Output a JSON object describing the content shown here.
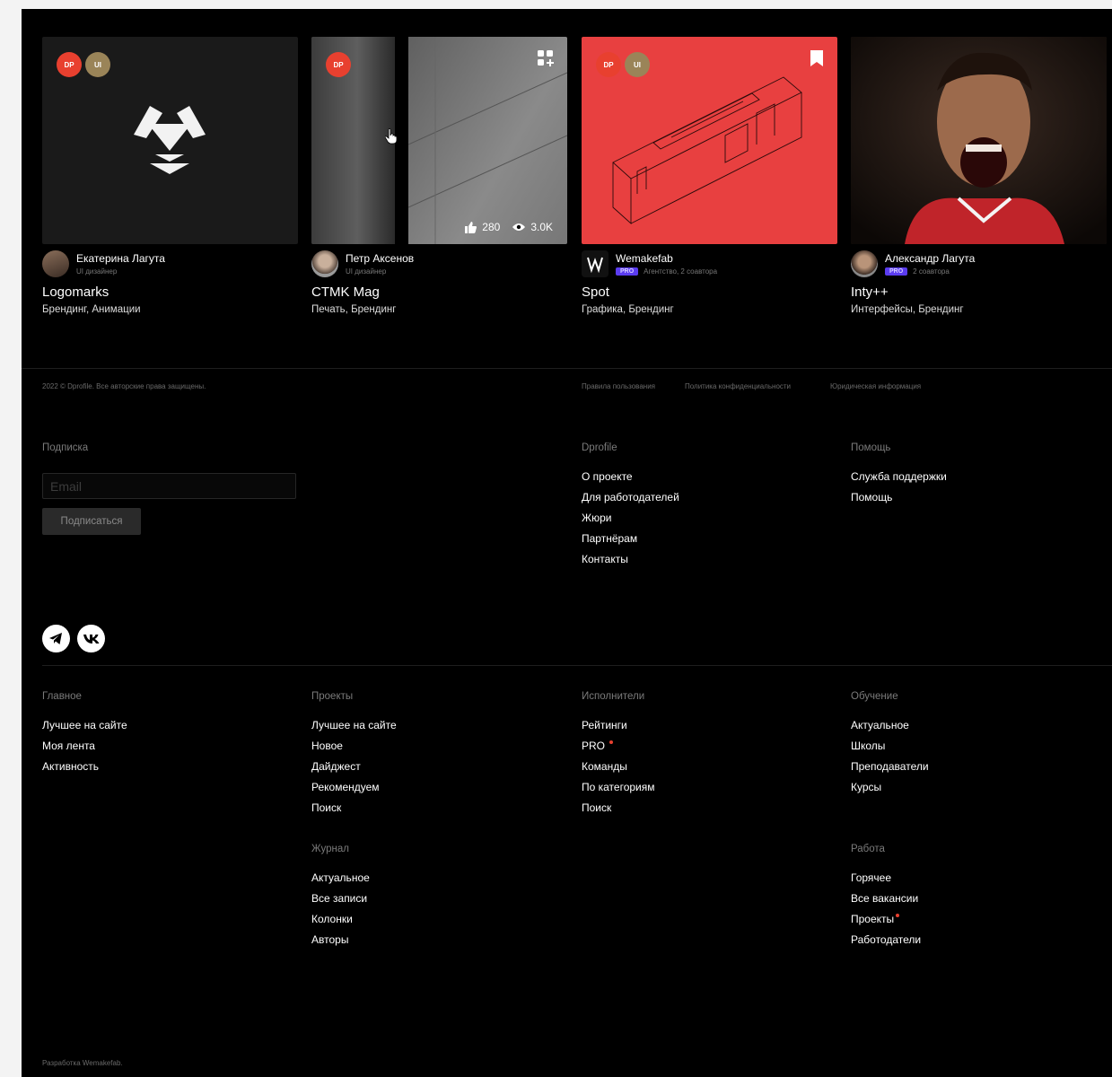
{
  "cards": [
    {
      "title": "Logomarks",
      "tags": "Брендинг, Анимации",
      "author": "Екатерина Лагута",
      "author_sub": "UI дизайнер",
      "badges": [
        "DP",
        "UI"
      ],
      "thumb_bg": "#1a1a1a"
    },
    {
      "title": "CTMK Mag",
      "tags": "Печать, Брендинг",
      "author": "Петр Аксенов",
      "author_sub": "UI дизайнер",
      "badges": [
        "DP"
      ],
      "likes": "280",
      "views": "3.0K",
      "thumb_bg": "#5a5a5a"
    },
    {
      "title": "Spot",
      "tags": "Графика, Брендинг",
      "author": "Wemakefab",
      "author_sub": "Агентство, 2 соавтора",
      "pro_label": "PRO",
      "badges": [
        "DP",
        "UI"
      ],
      "thumb_bg": "#e84040"
    },
    {
      "title": "Inty++",
      "tags": "Интерфейсы, Брендинг",
      "author": "Александр Лагута",
      "author_sub": "2 соавтора",
      "pro_label": "PRO",
      "thumb_bg": "#2a1a14"
    }
  ],
  "legal": {
    "copyright": "2022 © Dprofile. Все авторские права защищены.",
    "links": [
      "Правила пользования",
      "Политика конфиденциальности",
      "Юридическая информация"
    ]
  },
  "subscribe": {
    "heading": "Подписка",
    "placeholder": "Email",
    "button": "Подписаться"
  },
  "dprofile": {
    "heading": "Dprofile",
    "links": [
      "О проекте",
      "Для работодателей",
      "Жюри",
      "Партнёрам",
      "Контакты"
    ]
  },
  "help": {
    "heading": "Помощь",
    "links": [
      "Служба поддержки",
      "Помощь"
    ]
  },
  "nav": {
    "main": {
      "heading": "Главное",
      "links": [
        "Лучшее на сайте",
        "Моя лента",
        "Активность"
      ]
    },
    "projects": {
      "heading": "Проекты",
      "links": [
        "Лучшее на сайте",
        "Новое",
        "Дайджест",
        "Рекомендуем",
        "Поиск"
      ]
    },
    "performers": {
      "heading": "Исполнители",
      "links": [
        "Рейтинги",
        "PRO",
        "Команды",
        "По категориям",
        "Поиск"
      ]
    },
    "learning": {
      "heading": "Обучение",
      "links": [
        "Актуальное",
        "Школы",
        "Преподаватели",
        "Курсы"
      ]
    },
    "journal": {
      "heading": "Журнал",
      "links": [
        "Актуальное",
        "Все записи",
        "Колонки",
        "Авторы"
      ]
    },
    "work": {
      "heading": "Работа",
      "links": [
        "Горячее",
        "Все вакансии",
        "Проекты",
        "Работодатели"
      ]
    }
  },
  "dev_credit": "Разработка Wemakefab.",
  "colors": {
    "accent_red": "#e8402f",
    "pro_purple": "#5b3cf0",
    "background": "#000000"
  },
  "icons": [
    "telegram-icon",
    "vk-icon",
    "like-icon",
    "eye-icon",
    "bookmark-icon",
    "grid-plus-icon"
  ]
}
